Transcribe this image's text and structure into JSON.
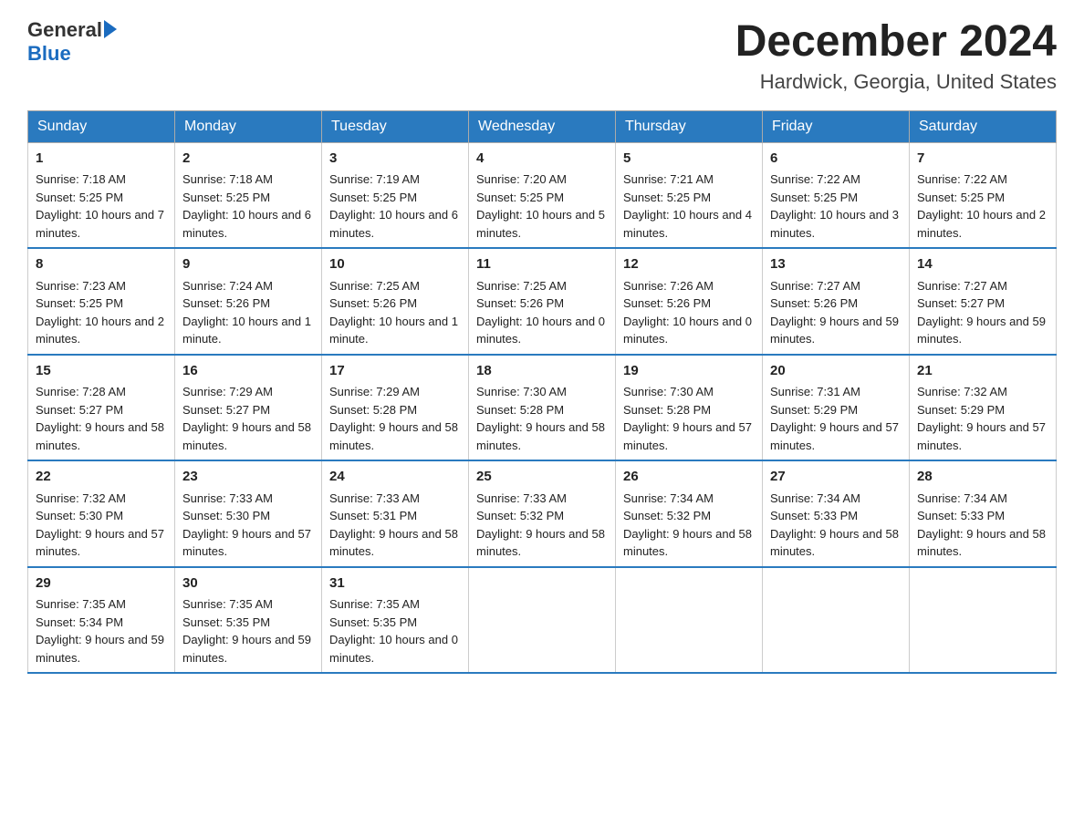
{
  "header": {
    "logo_general": "General",
    "logo_blue": "Blue",
    "month_title": "December 2024",
    "location": "Hardwick, Georgia, United States"
  },
  "days_of_week": [
    "Sunday",
    "Monday",
    "Tuesday",
    "Wednesday",
    "Thursday",
    "Friday",
    "Saturday"
  ],
  "weeks": [
    [
      {
        "day": "1",
        "sunrise": "7:18 AM",
        "sunset": "5:25 PM",
        "daylight": "10 hours and 7 minutes."
      },
      {
        "day": "2",
        "sunrise": "7:18 AM",
        "sunset": "5:25 PM",
        "daylight": "10 hours and 6 minutes."
      },
      {
        "day": "3",
        "sunrise": "7:19 AM",
        "sunset": "5:25 PM",
        "daylight": "10 hours and 6 minutes."
      },
      {
        "day": "4",
        "sunrise": "7:20 AM",
        "sunset": "5:25 PM",
        "daylight": "10 hours and 5 minutes."
      },
      {
        "day": "5",
        "sunrise": "7:21 AM",
        "sunset": "5:25 PM",
        "daylight": "10 hours and 4 minutes."
      },
      {
        "day": "6",
        "sunrise": "7:22 AM",
        "sunset": "5:25 PM",
        "daylight": "10 hours and 3 minutes."
      },
      {
        "day": "7",
        "sunrise": "7:22 AM",
        "sunset": "5:25 PM",
        "daylight": "10 hours and 2 minutes."
      }
    ],
    [
      {
        "day": "8",
        "sunrise": "7:23 AM",
        "sunset": "5:25 PM",
        "daylight": "10 hours and 2 minutes."
      },
      {
        "day": "9",
        "sunrise": "7:24 AM",
        "sunset": "5:26 PM",
        "daylight": "10 hours and 1 minute."
      },
      {
        "day": "10",
        "sunrise": "7:25 AM",
        "sunset": "5:26 PM",
        "daylight": "10 hours and 1 minute."
      },
      {
        "day": "11",
        "sunrise": "7:25 AM",
        "sunset": "5:26 PM",
        "daylight": "10 hours and 0 minutes."
      },
      {
        "day": "12",
        "sunrise": "7:26 AM",
        "sunset": "5:26 PM",
        "daylight": "10 hours and 0 minutes."
      },
      {
        "day": "13",
        "sunrise": "7:27 AM",
        "sunset": "5:26 PM",
        "daylight": "9 hours and 59 minutes."
      },
      {
        "day": "14",
        "sunrise": "7:27 AM",
        "sunset": "5:27 PM",
        "daylight": "9 hours and 59 minutes."
      }
    ],
    [
      {
        "day": "15",
        "sunrise": "7:28 AM",
        "sunset": "5:27 PM",
        "daylight": "9 hours and 58 minutes."
      },
      {
        "day": "16",
        "sunrise": "7:29 AM",
        "sunset": "5:27 PM",
        "daylight": "9 hours and 58 minutes."
      },
      {
        "day": "17",
        "sunrise": "7:29 AM",
        "sunset": "5:28 PM",
        "daylight": "9 hours and 58 minutes."
      },
      {
        "day": "18",
        "sunrise": "7:30 AM",
        "sunset": "5:28 PM",
        "daylight": "9 hours and 58 minutes."
      },
      {
        "day": "19",
        "sunrise": "7:30 AM",
        "sunset": "5:28 PM",
        "daylight": "9 hours and 57 minutes."
      },
      {
        "day": "20",
        "sunrise": "7:31 AM",
        "sunset": "5:29 PM",
        "daylight": "9 hours and 57 minutes."
      },
      {
        "day": "21",
        "sunrise": "7:32 AM",
        "sunset": "5:29 PM",
        "daylight": "9 hours and 57 minutes."
      }
    ],
    [
      {
        "day": "22",
        "sunrise": "7:32 AM",
        "sunset": "5:30 PM",
        "daylight": "9 hours and 57 minutes."
      },
      {
        "day": "23",
        "sunrise": "7:33 AM",
        "sunset": "5:30 PM",
        "daylight": "9 hours and 57 minutes."
      },
      {
        "day": "24",
        "sunrise": "7:33 AM",
        "sunset": "5:31 PM",
        "daylight": "9 hours and 58 minutes."
      },
      {
        "day": "25",
        "sunrise": "7:33 AM",
        "sunset": "5:32 PM",
        "daylight": "9 hours and 58 minutes."
      },
      {
        "day": "26",
        "sunrise": "7:34 AM",
        "sunset": "5:32 PM",
        "daylight": "9 hours and 58 minutes."
      },
      {
        "day": "27",
        "sunrise": "7:34 AM",
        "sunset": "5:33 PM",
        "daylight": "9 hours and 58 minutes."
      },
      {
        "day": "28",
        "sunrise": "7:34 AM",
        "sunset": "5:33 PM",
        "daylight": "9 hours and 58 minutes."
      }
    ],
    [
      {
        "day": "29",
        "sunrise": "7:35 AM",
        "sunset": "5:34 PM",
        "daylight": "9 hours and 59 minutes."
      },
      {
        "day": "30",
        "sunrise": "7:35 AM",
        "sunset": "5:35 PM",
        "daylight": "9 hours and 59 minutes."
      },
      {
        "day": "31",
        "sunrise": "7:35 AM",
        "sunset": "5:35 PM",
        "daylight": "10 hours and 0 minutes."
      },
      null,
      null,
      null,
      null
    ]
  ],
  "labels": {
    "sunrise": "Sunrise:",
    "sunset": "Sunset:",
    "daylight": "Daylight:"
  }
}
